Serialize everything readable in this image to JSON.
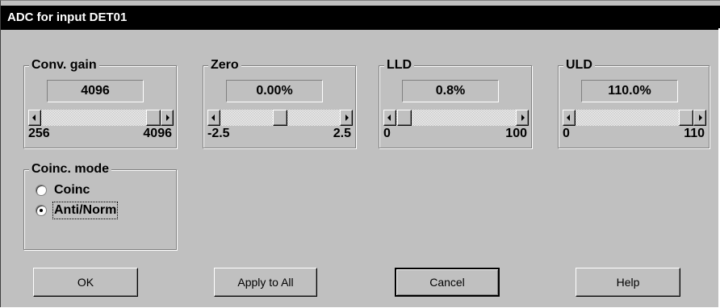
{
  "window": {
    "title": "ADC for input DET01"
  },
  "groups": {
    "conv_gain": {
      "label": "Conv. gain",
      "value": "4096",
      "min": "256",
      "max": "4096",
      "position": 1.0
    },
    "zero": {
      "label": "Zero",
      "value": "0.00%",
      "min": "-2.5",
      "max": "2.5",
      "position": 0.5
    },
    "lld": {
      "label": "LLD",
      "value": "0.8%",
      "min": "0",
      "max": "100",
      "position": 0.008
    },
    "uld": {
      "label": "ULD",
      "value": "110.0%",
      "min": "0",
      "max": "110",
      "position": 1.0
    }
  },
  "coinc_mode": {
    "label": "Coinc. mode",
    "options": [
      {
        "label": "Coinc",
        "selected": false
      },
      {
        "label": "Anti/Norm",
        "selected": true
      }
    ]
  },
  "buttons": {
    "ok": "OK",
    "apply_all": "Apply to All",
    "cancel": "Cancel",
    "help": "Help"
  }
}
